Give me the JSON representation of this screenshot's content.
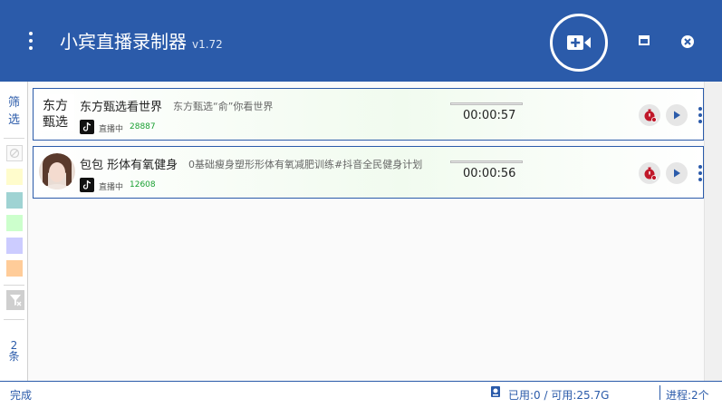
{
  "app": {
    "title": "小宾直播录制器",
    "version": "v1.72"
  },
  "sidebar": {
    "filter_label_1": "筛",
    "filter_label_2": "选",
    "swatches": [
      "#fffccc",
      "#9fd3d3",
      "#ccffcc",
      "#ccccff",
      "#ffcc99"
    ],
    "count_label_1": "2",
    "count_label_2": "条"
  },
  "streams": [
    {
      "name": "东方甄选看世界",
      "description": "东方甄选“俞”你看世界",
      "platform": "douyin-icon",
      "status": "直播中",
      "viewers": "28887",
      "elapsed": "00:00:57",
      "avatar_text": "东方甄选"
    },
    {
      "name": "包包 形体有氧健身",
      "description": "0基础瘦身塑形形体有氧减肥训练#抖音全民健身计划",
      "platform": "douyin-icon",
      "status": "直播中",
      "viewers": "12608",
      "elapsed": "00:00:56"
    }
  ],
  "statusbar": {
    "state": "完成",
    "disk": "已用:0 / 可用:25.7G",
    "process": "进程:2个"
  },
  "colors": {
    "primary": "#2b5baa",
    "stop": "#c0182a",
    "viewers": "#1aa032"
  }
}
